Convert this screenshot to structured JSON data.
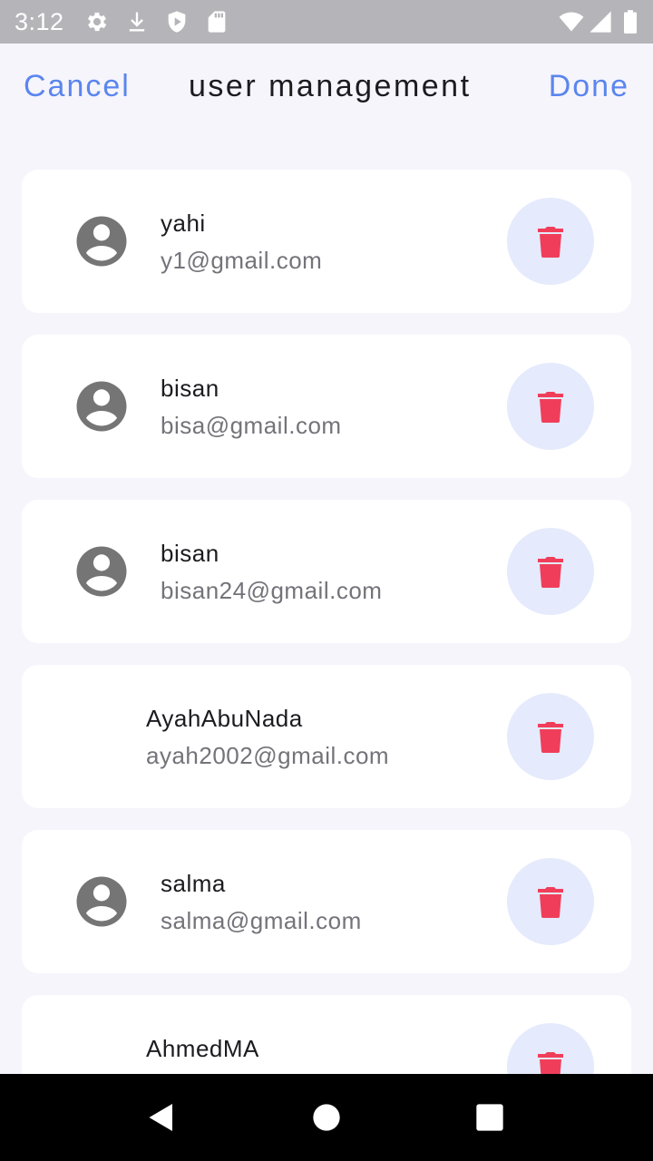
{
  "status_bar": {
    "time": "3:12",
    "icons": [
      "settings-icon",
      "download-icon",
      "shield-icon",
      "sd-card-icon",
      "wifi-icon",
      "signal-icon",
      "battery-icon"
    ]
  },
  "header": {
    "cancel_label": "Cancel",
    "title": "user management",
    "done_label": "Done"
  },
  "users": [
    {
      "name": "yahi",
      "email": "y1@gmail.com",
      "has_avatar": true
    },
    {
      "name": "bisan",
      "email": "bisa@gmail.com",
      "has_avatar": true
    },
    {
      "name": "bisan",
      "email": "bisan24@gmail.com",
      "has_avatar": true
    },
    {
      "name": "AyahAbuNada",
      "email": "ayah2002@gmail.com",
      "has_avatar": false
    },
    {
      "name": "salma",
      "email": "salma@gmail.com",
      "has_avatar": true
    },
    {
      "name": "AhmedMA",
      "email": "",
      "has_avatar": false
    }
  ],
  "colors": {
    "accent": "#5b86ee",
    "delete_icon": "#f03e5a",
    "delete_button_bg": "#e5eafc",
    "avatar": "#757575",
    "background": "#f6f5fc"
  },
  "nav_bar": {
    "buttons": [
      "back-icon",
      "home-icon",
      "recents-icon"
    ]
  }
}
